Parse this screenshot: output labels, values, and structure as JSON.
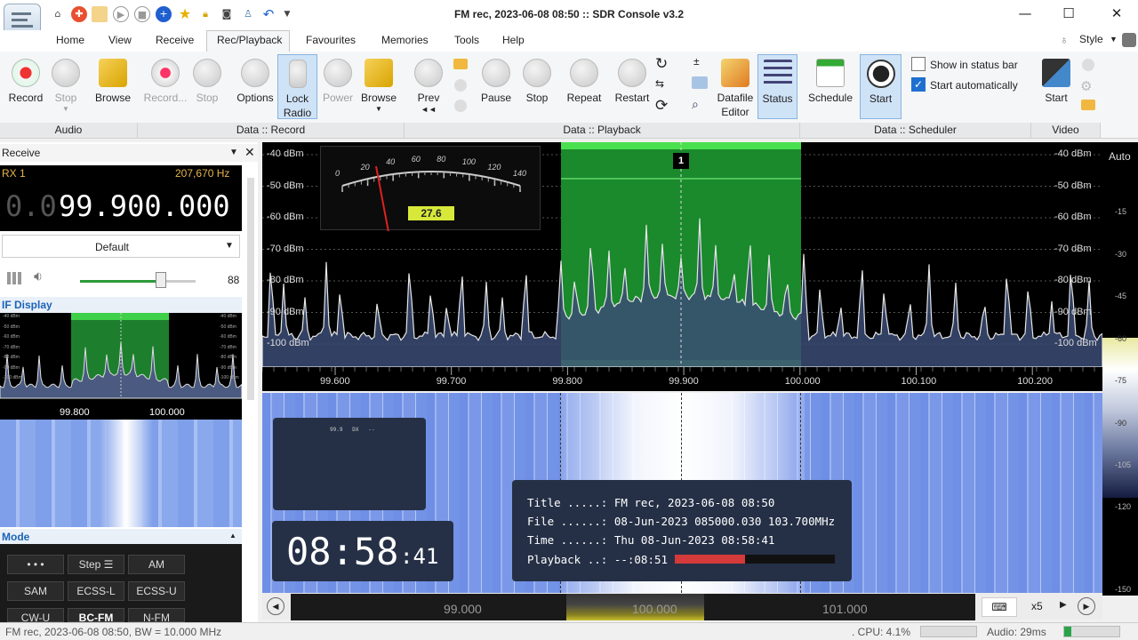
{
  "window": {
    "title": "FM rec, 2023-06-08 08:50 :: SDR Console v3.2"
  },
  "menu": [
    "Home",
    "View",
    "Receive",
    "Rec/Playback",
    "Favourites",
    "Memories",
    "Tools",
    "Help"
  ],
  "style_menu": "Style",
  "ribbon": {
    "audio": {
      "record": "Record",
      "stop": "Stop",
      "browse": "Browse",
      "group": "Audio"
    },
    "record": {
      "record": "Record...",
      "stop": "Stop",
      "options": "Options",
      "lock_radio": "Lock Radio",
      "power": "Power",
      "browse": "Browse",
      "group": "Data :: Record"
    },
    "playback": {
      "prev": "Prev",
      "pause": "Pause",
      "stop": "Stop",
      "repeat": "Repeat",
      "restart": "Restart",
      "datafile_editor": "Datafile Editor",
      "status": "Status",
      "group": "Data :: Playback"
    },
    "scheduler": {
      "schedule": "Schedule",
      "start": "Start",
      "show_status_bar": "Show in status bar",
      "start_auto": "Start automatically",
      "group": "Data :: Scheduler"
    },
    "video": {
      "start": "Start",
      "group": "Video"
    }
  },
  "receive": {
    "title": "Receive",
    "rx": "RX 1",
    "offset": "207,670 Hz",
    "freq_dim": "0.0",
    "freq": "99.900.000",
    "preset": "Default",
    "volume": "88",
    "volume_level": 0.7,
    "if_title": "IF Display",
    "if_ticks": [
      "99.800",
      "100.000"
    ],
    "mode_title": "Mode"
  },
  "modes": [
    "• • •",
    "Step ☰",
    "AM",
    "SAM",
    "ECSS-L",
    "ECSS-U",
    "CW-U",
    "BC-FM",
    "N-FM"
  ],
  "spectrum": {
    "dbm_labels": [
      "-40 dBm",
      "-50 dBm",
      "-60 dBm",
      "-70 dBm",
      "-80 dBm",
      "-90 dBm",
      "-100 dBm"
    ],
    "freq_labels": [
      "99.600",
      "99.700",
      "99.800",
      "99.900",
      "100.000",
      "100.100",
      "100.200"
    ],
    "marker": "1",
    "meter_ticks": [
      "0",
      "20",
      "40",
      "60",
      "80",
      "100",
      "120",
      "140"
    ],
    "meter_value": "27.6",
    "auto": "Auto",
    "scale": [
      "-15",
      "-30",
      "-45",
      "-60",
      "-75",
      "-90",
      "-105",
      "-120",
      "-150"
    ]
  },
  "clock": {
    "hm": "08:58",
    "s": ":41",
    "mini": "99.9   DX   --"
  },
  "info": {
    "title": "Title .....: FM rec, 2023-06-08 08:50",
    "file": "File ......: 08-Jun-2023 085000.030 103.700MHz",
    "time": "Time ......: Thu 08-Jun-2023 08:58:41",
    "playback": "Playback ..: --:08:51",
    "progress": 0.44
  },
  "freqbar": {
    "labels": [
      "99.000",
      "100.000",
      "101.000"
    ],
    "zoom": "x5"
  },
  "status": {
    "left": "FM rec, 2023-06-08 08:50, BW = 10.000 MHz",
    "cpu": ". CPU: 4.1%",
    "audio": "Audio: 29ms"
  }
}
